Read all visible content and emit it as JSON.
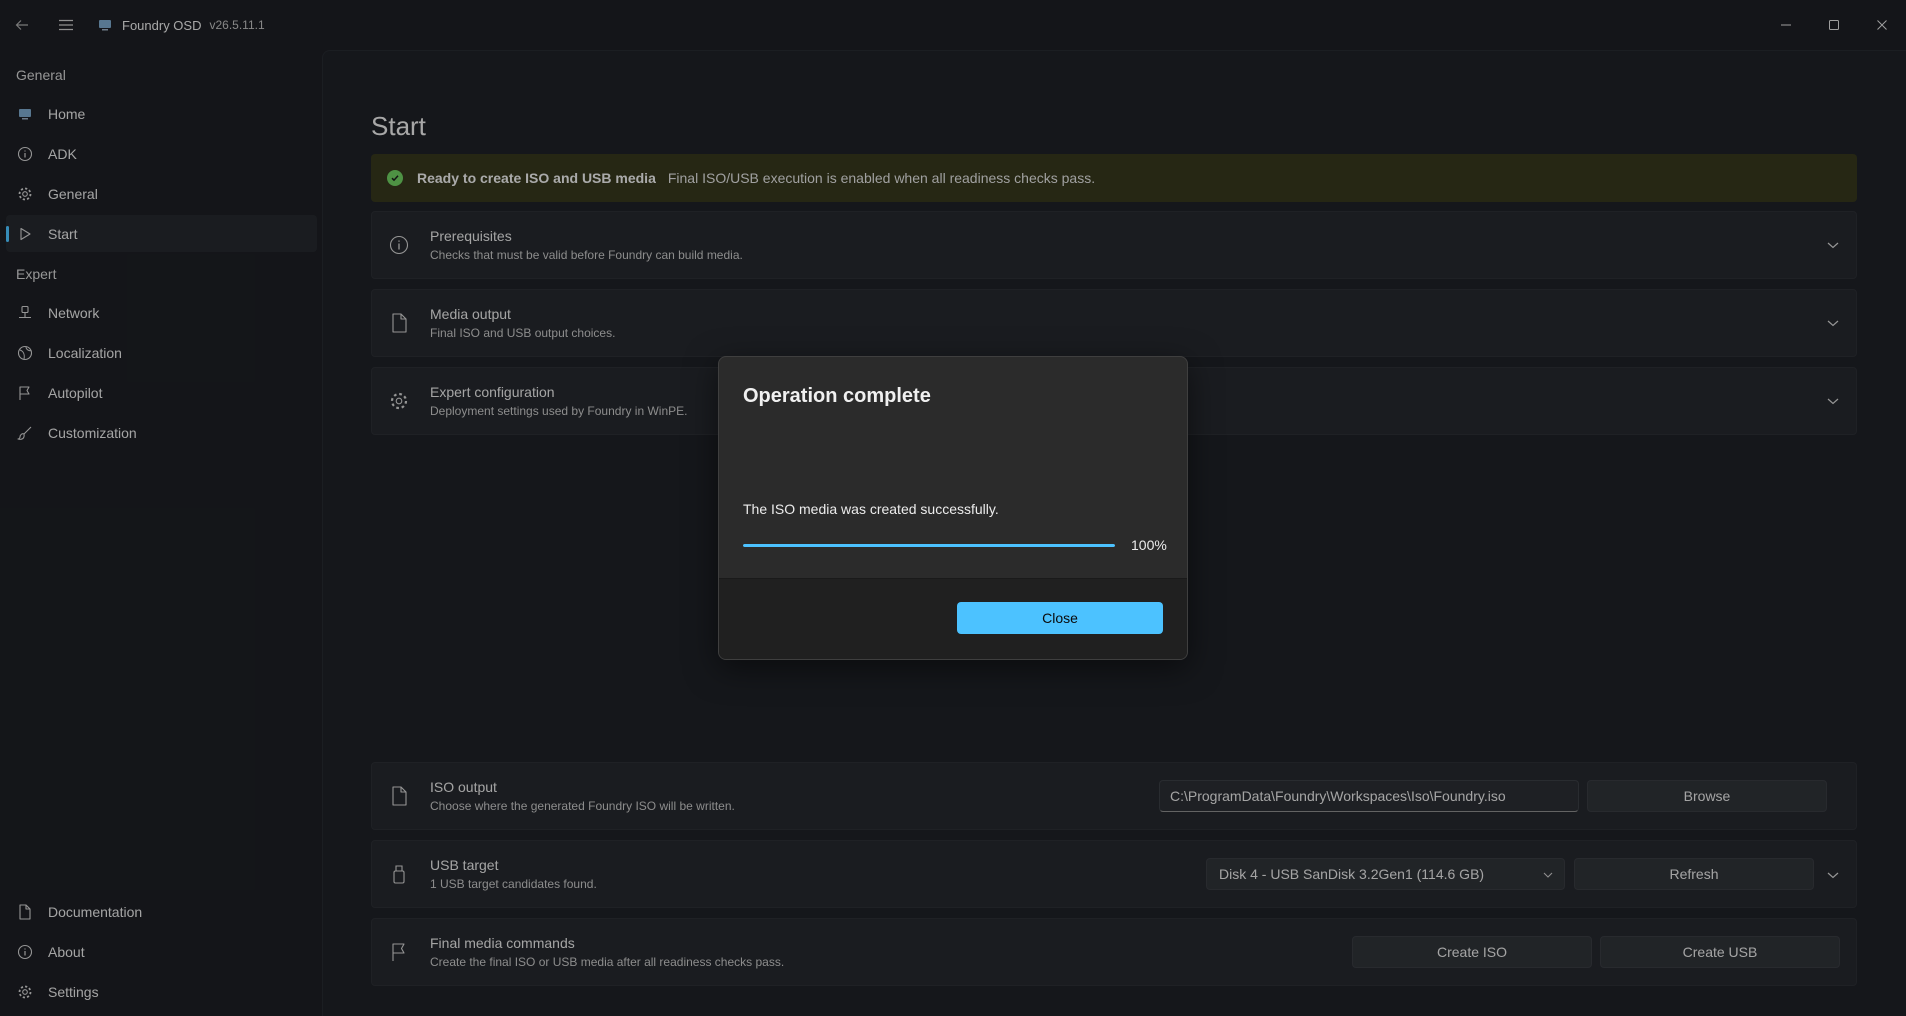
{
  "window": {
    "app_title": "Foundry OSD",
    "version": "v26.5.11.1"
  },
  "sidebar": {
    "section_general": "General",
    "section_expert": "Expert",
    "items": [
      {
        "label": "Home",
        "icon": "monitor-icon"
      },
      {
        "label": "ADK",
        "icon": "info-icon"
      },
      {
        "label": "General",
        "icon": "gear-icon"
      },
      {
        "label": "Start",
        "icon": "play-icon",
        "active": true
      },
      {
        "label": "Network",
        "icon": "network-icon"
      },
      {
        "label": "Localization",
        "icon": "globe-icon"
      },
      {
        "label": "Autopilot",
        "icon": "flag-icon"
      },
      {
        "label": "Customization",
        "icon": "brush-icon"
      }
    ],
    "footer_items": [
      {
        "label": "Documentation",
        "icon": "document-icon"
      },
      {
        "label": "About",
        "icon": "info-icon"
      },
      {
        "label": "Settings",
        "icon": "gear-icon"
      }
    ]
  },
  "main": {
    "title": "Start",
    "infobar": {
      "title": "Ready to create ISO and USB media",
      "message": "Final ISO/USB execution is enabled when all readiness checks pass.",
      "status_color": "#6ccb5f"
    },
    "sections": [
      {
        "title": "Prerequisites",
        "desc": "Checks that must be valid before Foundry can build media."
      },
      {
        "title": "Media output",
        "desc": "Final ISO and USB output choices."
      },
      {
        "title": "Expert configuration",
        "desc": "Deployment settings used by Foundry in WinPE."
      }
    ],
    "iso_output": {
      "title": "ISO output",
      "desc": "Choose where the generated Foundry ISO will be written.",
      "path": "C:\\ProgramData\\Foundry\\Workspaces\\Iso\\Foundry.iso",
      "browse_label": "Browse"
    },
    "usb_target": {
      "title": "USB target",
      "desc": "1 USB target candidates found.",
      "selected": "Disk 4 - USB SanDisk 3.2Gen1 (114.6 GB)",
      "refresh_label": "Refresh"
    },
    "final_commands": {
      "title": "Final media commands",
      "desc": "Create the final ISO or USB media after all readiness checks pass.",
      "create_iso_label": "Create ISO",
      "create_usb_label": "Create USB"
    }
  },
  "dialog": {
    "title": "Operation complete",
    "message": "The ISO media was created successfully.",
    "progress": 100,
    "progress_label": "100%",
    "close_label": "Close",
    "accent": "#4cc2ff"
  }
}
